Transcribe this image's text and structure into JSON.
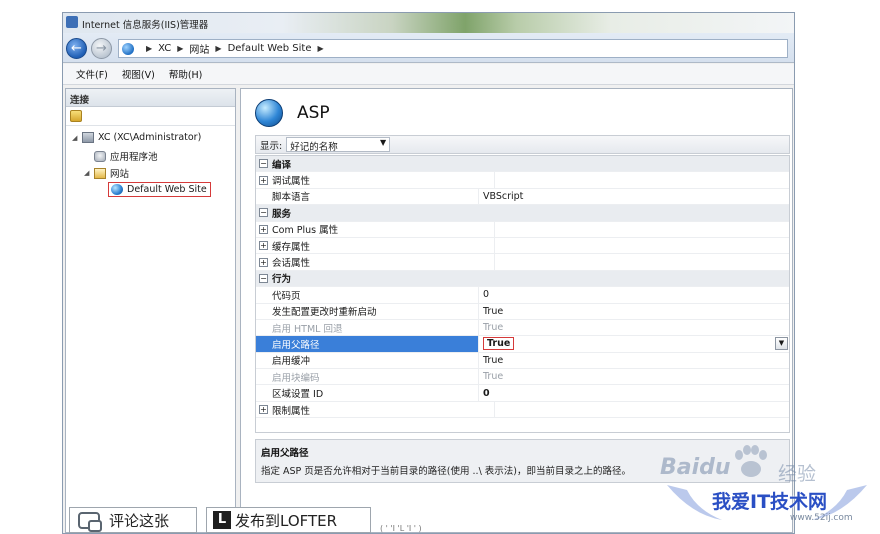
{
  "window": {
    "title": "Internet 信息服务(IIS)管理器"
  },
  "breadcrumb": [
    "XC",
    "网站",
    "Default Web Site"
  ],
  "menu": [
    "文件(F)",
    "视图(V)",
    "帮助(H)"
  ],
  "connections": {
    "header": "连接",
    "tree": {
      "server": "XC (XC\\Administrator)",
      "app_pools": "应用程序池",
      "sites": "网站",
      "default_site": "Default Web Site"
    }
  },
  "feature": {
    "title": "ASP",
    "display_label": "显示:",
    "display_value": "好记的名称"
  },
  "properties": [
    {
      "type": "category",
      "name": "编译"
    },
    {
      "type": "group",
      "name": "调试属性",
      "value": ""
    },
    {
      "type": "prop",
      "name": "脚本语言",
      "value": "VBScript"
    },
    {
      "type": "category",
      "name": "服务"
    },
    {
      "type": "group",
      "name": "Com Plus 属性",
      "value": ""
    },
    {
      "type": "group",
      "name": "缓存属性",
      "value": ""
    },
    {
      "type": "group",
      "name": "会话属性",
      "value": ""
    },
    {
      "type": "category",
      "name": "行为"
    },
    {
      "type": "prop",
      "name": "代码页",
      "value": "0"
    },
    {
      "type": "prop",
      "name": "发生配置更改时重新启动",
      "value": "True"
    },
    {
      "type": "prop",
      "name": "启用 HTML 回退",
      "value": "True",
      "disabled": true
    },
    {
      "type": "prop",
      "name": "启用父路径",
      "value": "True",
      "selected": true
    },
    {
      "type": "prop",
      "name": "启用缓冲",
      "value": "True"
    },
    {
      "type": "prop",
      "name": "启用块编码",
      "value": "True",
      "disabled": true
    },
    {
      "type": "prop",
      "name": "区域设置 ID",
      "value": "0",
      "bold": true
    },
    {
      "type": "group",
      "name": "限制属性",
      "value": ""
    }
  ],
  "description": {
    "title": "启用父路径",
    "text": "指定 ASP 页是否允许相对于当前目录的路径(使用 ..\\ 表示法)，即当前目录之上的路径。"
  },
  "share": {
    "comment_label": "评论这张",
    "lofter_icon": "L",
    "lofter_label": "发布到LOFTER"
  },
  "status_fragment": "( ' 'I 'L 'I ' )",
  "watermark": {
    "baidu": "Baidu",
    "jingyan": "经验",
    "site": "我爱IT技术网",
    "url": "www.52ij.com"
  },
  "icons": {
    "back": "arrow-left-icon",
    "forward": "arrow-right-icon",
    "globe": "globe-icon",
    "server": "server-icon",
    "app_pool": "app-pool-icon",
    "sites": "sites-folder-icon",
    "connect": "connect-icon",
    "comment": "comment-icon",
    "lofter": "lofter-icon"
  },
  "colors": {
    "selection": "#3a7fd9",
    "highlight_box": "#d53a3a",
    "watermark_blue": "#2a4fc4"
  }
}
